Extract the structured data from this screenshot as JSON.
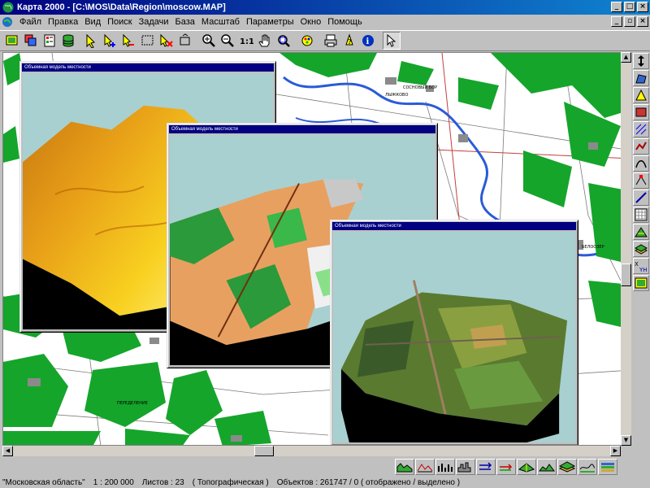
{
  "window": {
    "title": "Карта 2000 - [C:\\MOS\\Data\\Region\\moscow.MAP]"
  },
  "menu": [
    "Файл",
    "Правка",
    "Вид",
    "Поиск",
    "Задачи",
    "База",
    "Масштаб",
    "Параметры",
    "Окно",
    "Помощь"
  ],
  "toolbar_icons": [
    "open-map-icon",
    "layers-icon",
    "legend-icon",
    "database-icon",
    "select-icon",
    "select-plus-icon",
    "select-minus-icon",
    "frame-select-icon",
    "clear-select-icon",
    "move-icon",
    "zoom-in-icon",
    "zoom-out-icon",
    "zoom-1to1-icon",
    "pan-hand-icon",
    "zoom-all-icon",
    "paint-icon",
    "print-icon",
    "info-icon",
    "help-icon",
    "pointer-icon"
  ],
  "palette_icons": [
    "move-arrow-icon",
    "polygon-tool-icon",
    "triangle-tool-icon",
    "object-tool-icon",
    "hatch-tool-icon",
    "line-tool-icon",
    "curve-tool-icon",
    "node-tool-icon",
    "table-tool-icon",
    "matrix-tool-icon",
    "grid-tool-icon",
    "layer3d-tool-icon",
    "coords-tool-icon",
    "layer-view-icon"
  ],
  "windows3d": [
    {
      "caption": "Объемная модель местности"
    },
    {
      "caption": "Объемная модель местности"
    },
    {
      "caption": "Объемная модель местности"
    }
  ],
  "status": {
    "region": "\"Московская область\"",
    "scale": "1 : 200 000",
    "sheets": "Листов : 23",
    "type": "( Топографическая )",
    "objects": "Объектов : 261747 / 0 ( отображено / выделено )"
  },
  "map_labels": [
    "СОСНОВЫЙ БОР",
    "ЛЫЖКОВО",
    "БЕЛООЗЕР",
    "ПЕРЕДЕЛЕНИЕ"
  ],
  "colors": {
    "title_bar": "#000080",
    "forest": "#15a52b",
    "water": "#2a5bd7",
    "sky": "#a8d0d0"
  }
}
